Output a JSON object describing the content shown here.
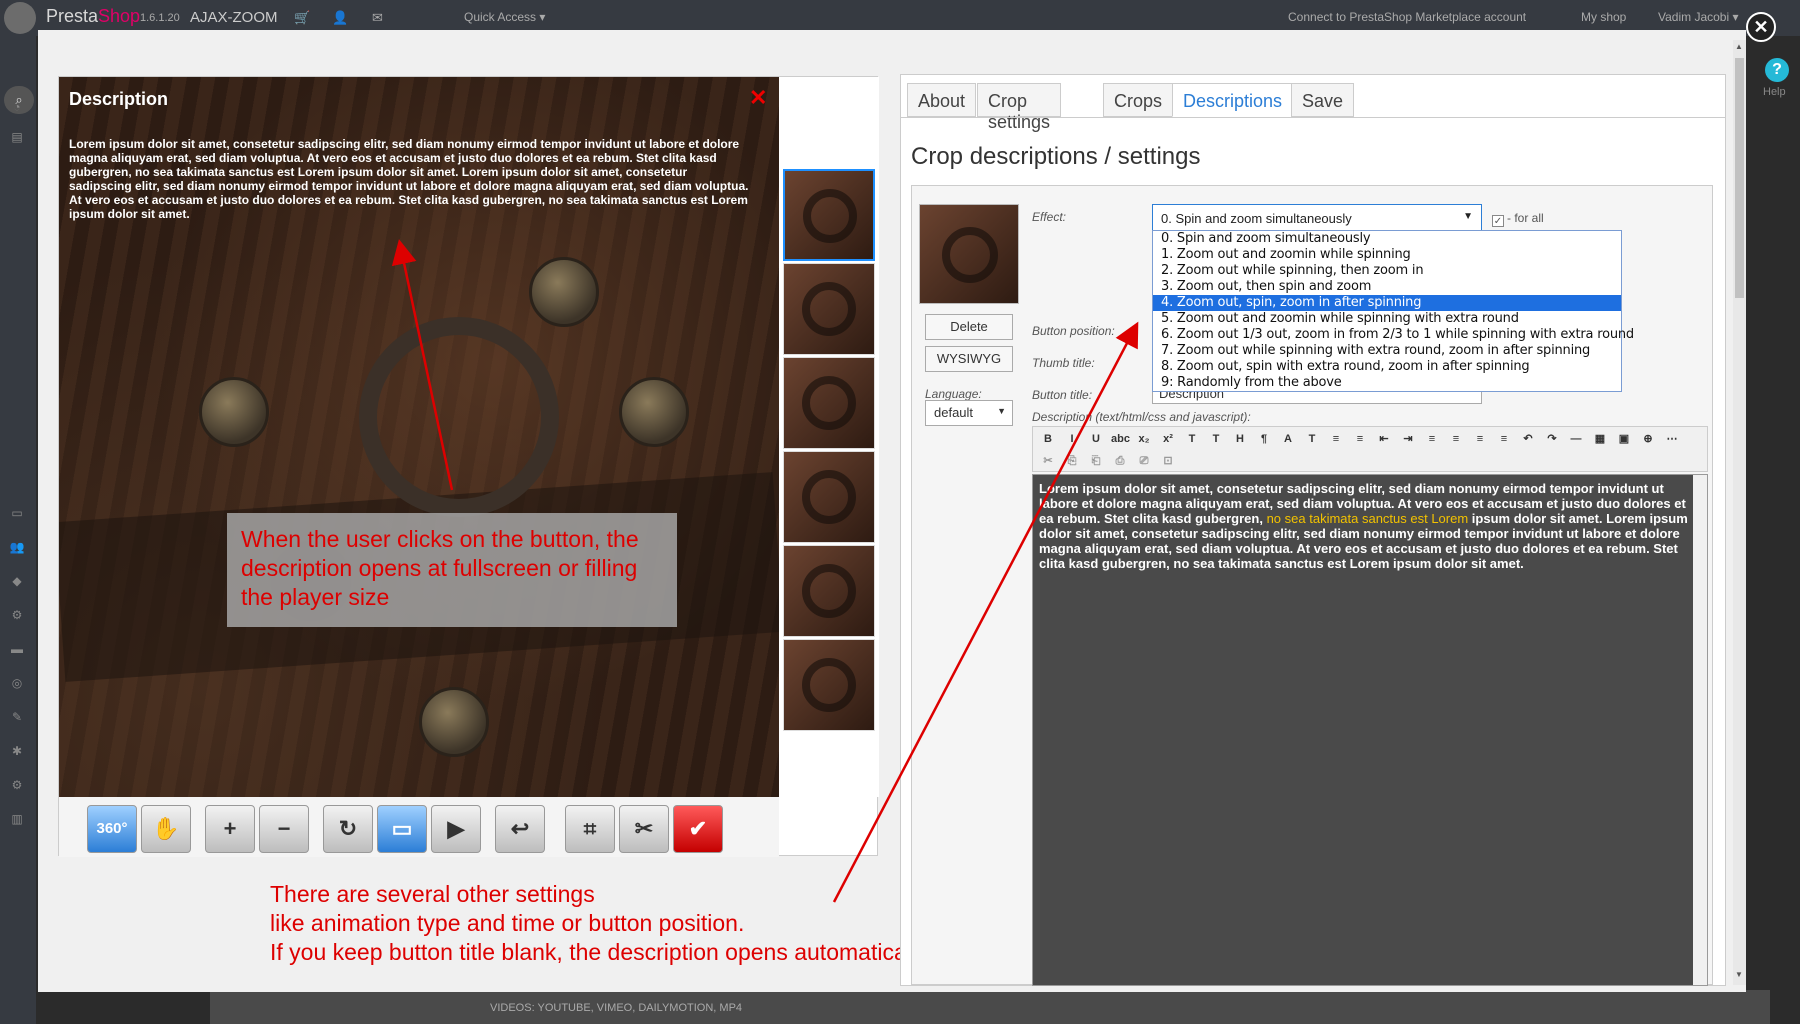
{
  "topbar": {
    "brand_left": "Presta",
    "brand_right": "Shop",
    "version": "1.6.1.20",
    "shop_name": "AJAX-ZOOM",
    "quick_access": "Quick Access ▾",
    "marketplace": "Connect to PrestaShop Marketplace account",
    "my_shop": "My shop",
    "user": "Vadim Jacobi ▾"
  },
  "help": {
    "label": "Help"
  },
  "player": {
    "desc_title": "Description",
    "desc_close": "✕",
    "desc_text": "Lorem ipsum dolor sit amet, consetetur sadipscing elitr, sed diam nonumy eirmod tempor invidunt ut labore et dolore magna aliquyam erat, sed diam voluptua. At vero eos et accusam et justo duo dolores et ea rebum. Stet clita kasd gubergren, no sea takimata sanctus est Lorem ipsum dolor sit amet. Lorem ipsum dolor sit amet, consetetur sadipscing elitr, sed diam nonumy eirmod tempor invidunt ut labore et dolore magna aliquyam erat, sed diam voluptua. At vero eos et accusam et justo duo dolores et ea rebum. Stet clita kasd gubergren, no sea takimata sanctus est Lorem ipsum dolor sit amet.",
    "toolbar": {
      "btn_360": "360°",
      "btn_pan": "✋",
      "btn_zoom_in": "+",
      "btn_zoom_out": "−",
      "btn_rotate": "↻",
      "btn_fullscreen": "▭",
      "btn_play": "▶",
      "btn_back": "↩",
      "btn_crop": "⌗",
      "btn_tools": "✂",
      "btn_check": "✔"
    }
  },
  "annotations": {
    "callout1": "When the user clicks on the button, the description opens at fullscreen or filling the player size",
    "callout2_line1": "There are several other settings",
    "callout2_line2": "like animation type and time or button position.",
    "callout2_line3": "If you keep button title blank, the description opens automatically."
  },
  "tabs": [
    "About",
    "Crop settings",
    "Crops",
    "Descriptions",
    "Save"
  ],
  "panel": {
    "title": "Crop descriptions / settings",
    "delete": "Delete",
    "wysiwyg": "WYSIWYG",
    "language_label": "Language:",
    "language_value": "default",
    "effect_label": "Effect:",
    "effect_value": "0. Spin and zoom simultaneously",
    "for_all": "- for all",
    "button_position_label": "Button position:",
    "thumb_title_label": "Thumb title:",
    "button_title_label": "Button title:",
    "button_title_value": "Description",
    "description_label": "Description (text/html/css and javascript):",
    "effect_options": [
      "0. Spin and zoom simultaneously",
      "1. Zoom out and zoomin while spinning",
      "2. Zoom out while spinning, then zoom in",
      "3. Zoom out, then spin and zoom",
      "4. Zoom out, spin, zoom in after spinning",
      "5. Zoom out and zoomin while spinning with extra round",
      "6. Zoom out 1/3 out, zoom in from 2/3 to 1 while spinning with extra round",
      "7. Zoom out while spinning with extra round, zoom in after spinning",
      "8. Zoom out, spin with extra round, zoom in after spinning",
      "9: Randomly from the above"
    ],
    "selected_option": 4,
    "editor_text_a": "Lorem ipsum dolor sit amet, consetetur sadipscing elitr, sed diam nonumy eirmod tempor invidunt ut labore et dolore magna aliquyam erat, sed diam voluptua. At vero eos et accusam et justo duo dolores et ea rebum. Stet clita kasd gubergren, ",
    "editor_text_hl": "no sea takimata sanctus est Lorem",
    "editor_text_b": " ipsum dolor sit amet. Lorem ipsum dolor sit amet, consetetur sadipscing elitr, sed diam nonumy eirmod tempor invidunt ut labore et dolore magna aliquyam erat, sed diam voluptua. At vero eos et accusam et justo duo dolores et ea rebum. Stet clita kasd gubergren, no sea takimata sanctus est Lorem ipsum dolor sit amet."
  },
  "editor_toolbar": {
    "row1": [
      "B",
      "I",
      "U",
      "abc",
      "x₂",
      "x²",
      "T",
      "T",
      "H",
      "¶",
      "A",
      "T",
      "≡",
      "≡",
      "⇤",
      "⇥",
      "≡",
      "≡",
      "≡",
      "≡",
      "↶",
      "↷",
      "—",
      "▦",
      "▣",
      "⊕",
      "⋯"
    ],
    "row2": [
      "✂",
      "⎘",
      "⎗",
      "⎙",
      "⎚",
      "⊡"
    ]
  },
  "background": {
    "footer_text": "VIDEOS: YOUTUBE, VIMEO, DAILYMOTION, MP4"
  },
  "colors": {
    "accent": "#2c7ed6",
    "annotation": "#dd0000",
    "selected_option": "#1e6fe0"
  }
}
